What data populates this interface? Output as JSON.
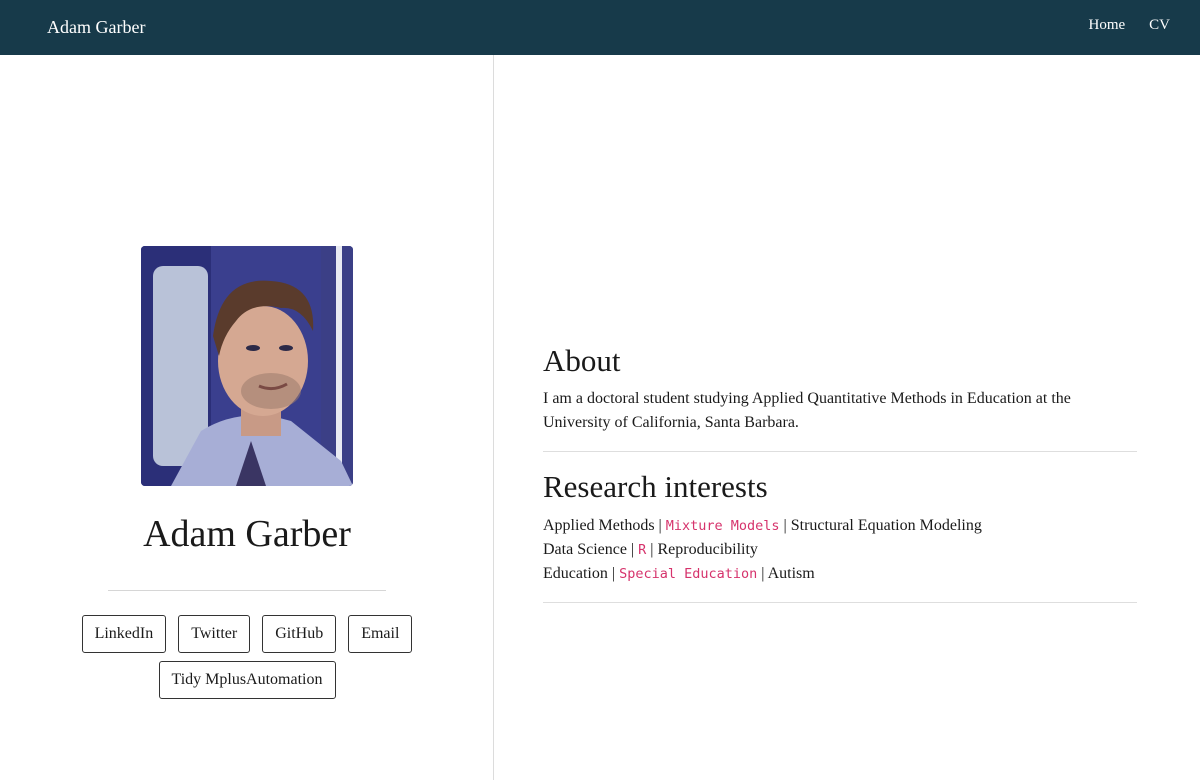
{
  "navbar": {
    "brand": "Adam Garber",
    "links": [
      "Home",
      "CV"
    ]
  },
  "profile": {
    "name": "Adam Garber",
    "buttons_row1": [
      "LinkedIn",
      "Twitter",
      "GitHub",
      "Email"
    ],
    "buttons_row2": [
      "Tidy MplusAutomation"
    ]
  },
  "about": {
    "title": "About",
    "text": "I am a doctoral student studying Applied Quantitative Methods in Education at the University of California, Santa Barbara."
  },
  "research": {
    "title": "Research interests",
    "lines": [
      {
        "category": "Applied Methods",
        "sep": "|",
        "highlight": "Mixture Models",
        "rest": "Structural Equation Modeling"
      },
      {
        "category": "Data Science",
        "sep": "|",
        "highlight": "R",
        "rest": "Reproducibility"
      },
      {
        "category": "Education",
        "sep": "|",
        "highlight": "Special Education",
        "rest": "Autism"
      }
    ]
  },
  "colors": {
    "navbar_bg": "#173a4a",
    "code_pink": "#d6336c"
  },
  "icons": {
    "avatar": "profile-photo"
  }
}
